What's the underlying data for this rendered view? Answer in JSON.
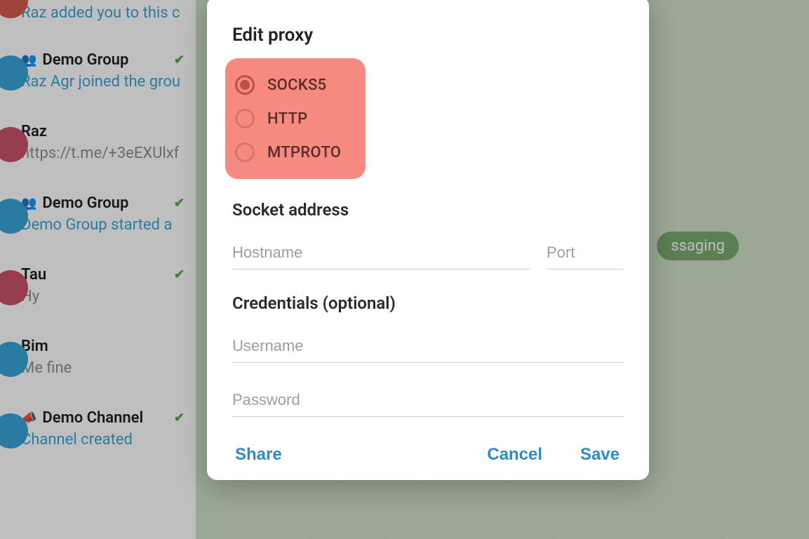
{
  "sidebar": {
    "items": [
      {
        "name": "",
        "sub": "Raz added you to this c",
        "group": false,
        "checked": false,
        "subGray": false,
        "avatar": "#d65a4e"
      },
      {
        "name": "Demo Group",
        "sub": "Raz Agr joined the grou",
        "group": true,
        "checked": true,
        "subGray": false,
        "avatar": "#3aa3d9"
      },
      {
        "name": "Raz",
        "sub": "https://t.me/+3eEXUlxf",
        "group": false,
        "checked": false,
        "subGray": true,
        "avatar": "#c9506a"
      },
      {
        "name": "Demo Group",
        "sub": "Demo Group started a",
        "group": true,
        "checked": true,
        "subGray": false,
        "avatar": "#3aa3d9"
      },
      {
        "name": "Tau",
        "sub": "Hy",
        "group": false,
        "checked": true,
        "subGray": true,
        "avatar": "#c9506a"
      },
      {
        "name": "Bim",
        "sub": "Me fine",
        "group": false,
        "checked": false,
        "subGray": true,
        "avatar": "#3aa3d9"
      },
      {
        "name": "Demo Channel",
        "sub": "Channel created",
        "group": false,
        "channel": true,
        "checked": true,
        "subGray": false,
        "avatar": "#3aa3d9"
      }
    ]
  },
  "chat_pane": {
    "messaging_label": "ssaging"
  },
  "modal": {
    "title": "Edit proxy",
    "protocols": [
      {
        "label": "SOCKS5",
        "selected": true
      },
      {
        "label": "HTTP",
        "selected": false
      },
      {
        "label": "MTPROTO",
        "selected": false
      }
    ],
    "socket_section": "Socket address",
    "hostname_placeholder": "Hostname",
    "port_placeholder": "Port",
    "credentials_section": "Credentials (optional)",
    "username_placeholder": "Username",
    "password_placeholder": "Password",
    "share_label": "Share",
    "cancel_label": "Cancel",
    "save_label": "Save"
  }
}
